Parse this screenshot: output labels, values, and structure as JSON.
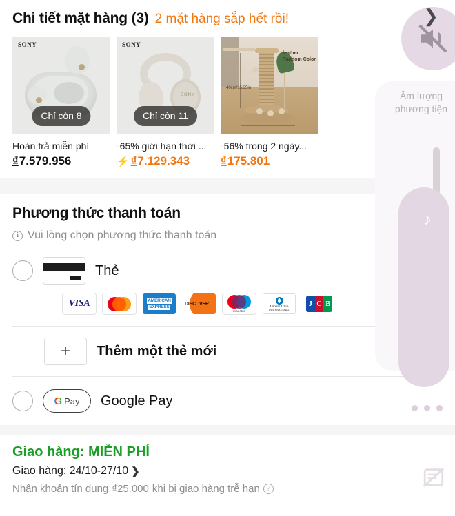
{
  "items_section": {
    "title": "Chi tiết mặt hàng (3)",
    "warning": "2 mặt hàng sắp hết rồi!",
    "products": [
      {
        "brand": "SONY",
        "stock_badge": "Chỉ còn 8",
        "label": "Hoàn trả miễn phí",
        "currency": "₫",
        "price": "7.579.956",
        "is_deal": false
      },
      {
        "brand": "SONY",
        "stock_badge": "Chỉ còn 11",
        "label": "-65% giới hạn thời ...",
        "currency": "₫",
        "price": "7.129.343",
        "is_deal": true
      },
      {
        "brand": "",
        "stock_badge": "",
        "label": "-56% trong 2 ngày...",
        "currency": "₫",
        "price": "175.801",
        "is_deal": true,
        "image_text_1": "feather",
        "image_text_2": "Random Color",
        "image_dim": "40cm/15.35in"
      }
    ]
  },
  "payment_section": {
    "title": "Phương thức thanh toán",
    "hint": "Vui lòng chọn phương thức thanh toán",
    "card_option_label": "Thẻ",
    "brands": [
      "VISA",
      "Mastercard",
      "AMERICAN EXPRESS",
      "DISCOVER",
      "maestro",
      "Diners Club INTERNATIONAL",
      "JCB"
    ],
    "brand_texts": {
      "visa": "VISA",
      "amex_line1": "AMERICAN",
      "amex_line2": "EXPRESS",
      "discover": "DISC",
      "discover_tail": "VER",
      "maestro": "maestro",
      "diners_line1": "Diners Club",
      "diners_line2": "INTERNATIONAL",
      "jcb_j": "J",
      "jcb_c": "C",
      "jcb_b": "B"
    },
    "add_card_label": "Thêm một thẻ mới",
    "add_card_plus": "+",
    "gpay_label": "Google Pay",
    "gpay_g": "G",
    "gpay_word": "Pay"
  },
  "shipping_section": {
    "free_label": "Giao hàng: MIỄN PHÍ",
    "date_label": "Giao hàng: 24/10-27/10",
    "date_chevron": "❯",
    "note_prefix": "Nhận khoản tín dụng ",
    "note_amount": "₫25.000",
    "note_suffix": " khi bị giao hàng trễ hạn",
    "note_help": "?"
  },
  "overlay": {
    "top_chevron": "❯",
    "volume_label_line1": "Âm lượng",
    "volume_label_line2": "phương tiện",
    "music_note": "♪"
  },
  "colors": {
    "accent_orange": "#f2760c",
    "green": "#1a9e26",
    "overlay_purple": "#e5d9e5"
  }
}
